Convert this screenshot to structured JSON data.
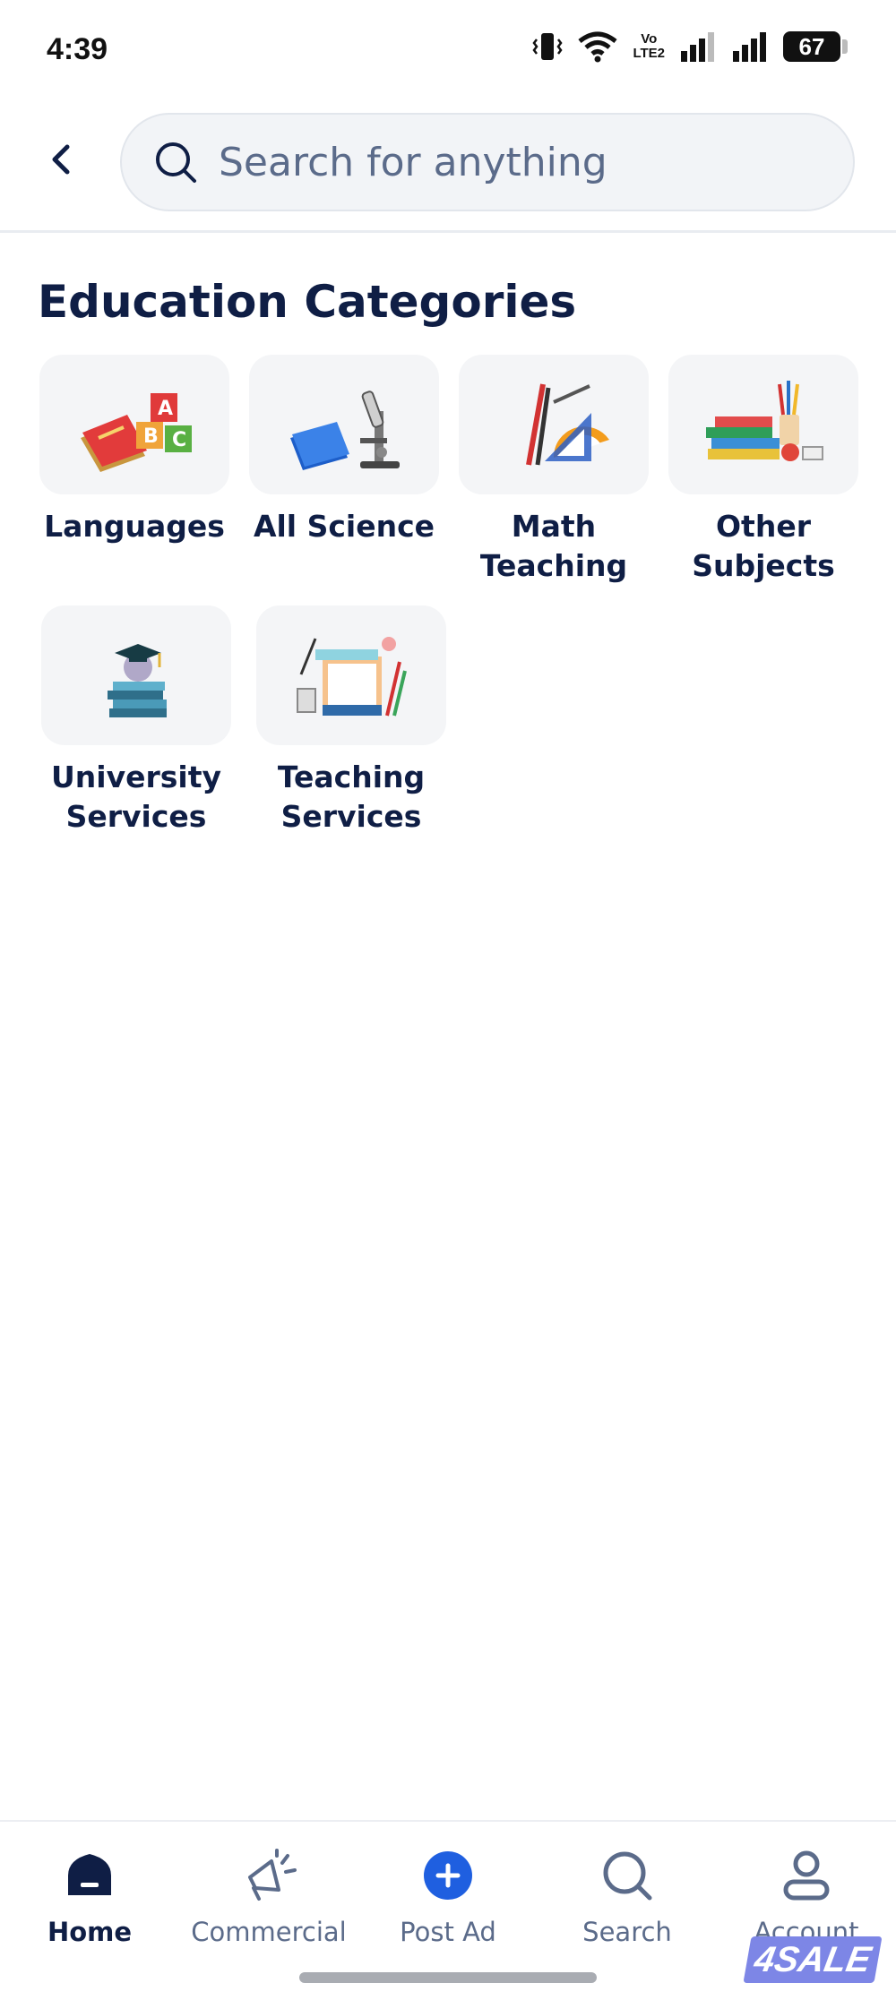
{
  "status_bar": {
    "time": "4:39",
    "battery": "67",
    "network_label_top": "Vo",
    "network_label_bottom": "LTE2"
  },
  "search": {
    "placeholder": "Search for anything"
  },
  "page": {
    "title": "Education Categories"
  },
  "categories": [
    {
      "label_line1": "Languages",
      "label_line2": "",
      "icon": "abc-blocks-books-icon"
    },
    {
      "label_line1": "All Science",
      "label_line2": "",
      "icon": "microscope-book-icon"
    },
    {
      "label_line1": "Math",
      "label_line2": "Teaching",
      "icon": "ruler-protractor-pencil-icon"
    },
    {
      "label_line1": "Other",
      "label_line2": "Subjects",
      "icon": "books-pencil-cup-icon"
    },
    {
      "label_line1": "University",
      "label_line2": "Services",
      "icon": "graduation-cap-books-icon"
    },
    {
      "label_line1": "Teaching",
      "label_line2": "Services",
      "icon": "stationery-board-icon"
    }
  ],
  "bottom_nav": {
    "items": [
      {
        "label": "Home",
        "icon": "home-icon",
        "active": true
      },
      {
        "label": "Commercial",
        "icon": "megaphone-icon",
        "active": false
      },
      {
        "label": "Post Ad",
        "icon": "plus-circle-icon",
        "active": false
      },
      {
        "label": "Search",
        "icon": "search-icon",
        "active": false
      },
      {
        "label": "Account",
        "icon": "user-icon",
        "active": false
      }
    ]
  },
  "watermark": "4SALE",
  "colors": {
    "primary_navy": "#0f1e45",
    "accent_blue": "#1f5fe0",
    "muted_text": "#5b6b8a",
    "tile_bg": "#f4f5f7"
  }
}
